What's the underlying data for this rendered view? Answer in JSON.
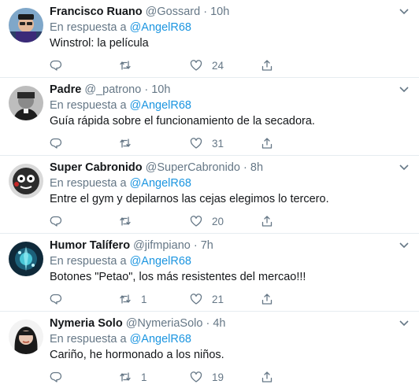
{
  "tweets": [
    {
      "name": "Francisco Ruano",
      "handle": "@Gossard",
      "time": "10h",
      "reply_prefix": "En respuesta a",
      "reply_mention": "@AngelR68",
      "text": "Winstrol: la película",
      "retweets": "",
      "likes": "24"
    },
    {
      "name": "Padre",
      "handle": "@_patrono",
      "time": "10h",
      "reply_prefix": "En respuesta a",
      "reply_mention": "@AngelR68",
      "text": "Guía rápida sobre el funcionamiento de la secadora.",
      "retweets": "",
      "likes": "31"
    },
    {
      "name": "Super Cabronido",
      "handle": "@SuperCabronido",
      "time": "8h",
      "reply_prefix": "En respuesta a",
      "reply_mention": "@AngelR68",
      "text": "Entre el gym y depilarnos las cejas elegimos lo tercero.",
      "retweets": "",
      "likes": "20"
    },
    {
      "name": "Humor Talífero",
      "handle": "@jifmpiano",
      "time": "7h",
      "reply_prefix": "En respuesta a",
      "reply_mention": "@AngelR68",
      "text": "Botones \"Petao\", los más resistentes del mercao!!!",
      "retweets": "1",
      "likes": "21"
    },
    {
      "name": "Nymeria Solo",
      "handle": "@NymeriaSolo",
      "time": "4h",
      "reply_prefix": "En respuesta a",
      "reply_mention": "@AngelR68",
      "text": "Cariño, he hormonado a los niños.",
      "retweets": "1",
      "likes": "19"
    }
  ],
  "separator": "·",
  "colors": {
    "link": "#1b95e0",
    "muted": "#657786",
    "text": "#14171a",
    "divider": "#e6ecf0"
  },
  "icons": [
    "reply-icon",
    "retweet-icon",
    "like-icon",
    "share-icon",
    "chevron-down-icon"
  ]
}
